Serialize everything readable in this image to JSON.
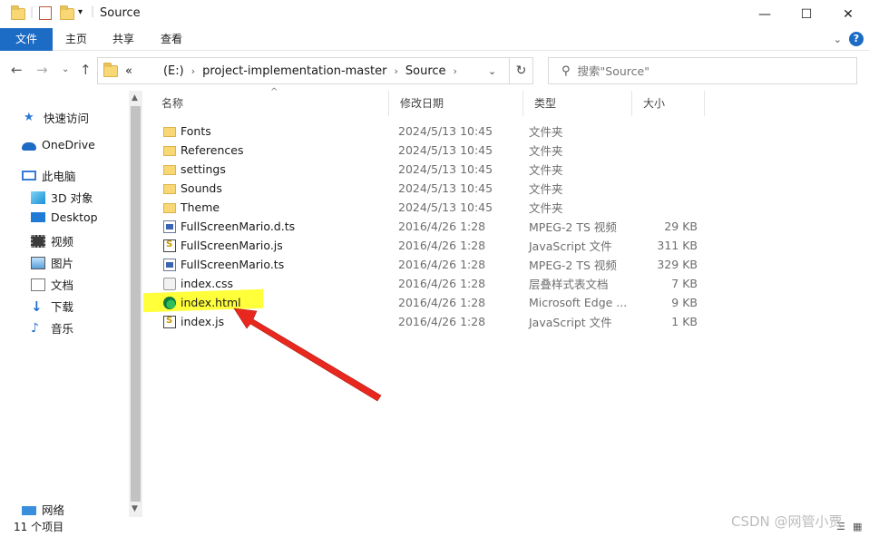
{
  "window": {
    "title": "Source",
    "controls": {
      "minimize": "—",
      "maximize": "☐",
      "close": "✕"
    }
  },
  "ribbon": {
    "tabs": [
      {
        "label": "文件",
        "active": true
      },
      {
        "label": "主页"
      },
      {
        "label": "共享"
      },
      {
        "label": "查看"
      }
    ],
    "help": "?"
  },
  "address": {
    "overflow": "«",
    "crumbs": [
      "(E:)",
      "project-implementation-master",
      "Source"
    ]
  },
  "search": {
    "placeholder": "搜索\"Source\""
  },
  "sidebar": {
    "items": [
      {
        "label": "快速访问",
        "icon": "star-icon"
      },
      {
        "label": "OneDrive",
        "icon": "cloud-icon"
      },
      {
        "label": "此电脑",
        "icon": "computer-icon"
      },
      {
        "label": "3D 对象",
        "icon": "cube-icon"
      },
      {
        "label": "Desktop",
        "icon": "desktop-icon"
      },
      {
        "label": "视频",
        "icon": "video-icon"
      },
      {
        "label": "图片",
        "icon": "picture-icon"
      },
      {
        "label": "文档",
        "icon": "document-icon"
      },
      {
        "label": "下载",
        "icon": "download-icon"
      },
      {
        "label": "音乐",
        "icon": "music-icon"
      },
      {
        "label": "网络",
        "icon": "network-icon"
      }
    ]
  },
  "columns": {
    "name": "名称",
    "date": "修改日期",
    "type": "类型",
    "size": "大小"
  },
  "files": [
    {
      "name": "Fonts",
      "date": "2024/5/13 10:45",
      "type": "文件夹",
      "size": "",
      "icon": "folder"
    },
    {
      "name": "References",
      "date": "2024/5/13 10:45",
      "type": "文件夹",
      "size": "",
      "icon": "folder"
    },
    {
      "name": "settings",
      "date": "2024/5/13 10:45",
      "type": "文件夹",
      "size": "",
      "icon": "folder"
    },
    {
      "name": "Sounds",
      "date": "2024/5/13 10:45",
      "type": "文件夹",
      "size": "",
      "icon": "folder"
    },
    {
      "name": "Theme",
      "date": "2024/5/13 10:45",
      "type": "文件夹",
      "size": "",
      "icon": "folder"
    },
    {
      "name": "FullScreenMario.d.ts",
      "date": "2016/4/26 1:28",
      "type": "MPEG-2 TS 视频",
      "size": "29 KB",
      "icon": "ts"
    },
    {
      "name": "FullScreenMario.js",
      "date": "2016/4/26 1:28",
      "type": "JavaScript 文件",
      "size": "311 KB",
      "icon": "js"
    },
    {
      "name": "FullScreenMario.ts",
      "date": "2016/4/26 1:28",
      "type": "MPEG-2 TS 视频",
      "size": "329 KB",
      "icon": "ts"
    },
    {
      "name": "index.css",
      "date": "2016/4/26 1:28",
      "type": "层叠样式表文档",
      "size": "7 KB",
      "icon": "css"
    },
    {
      "name": "index.html",
      "date": "2016/4/26 1:28",
      "type": "Microsoft Edge ...",
      "size": "9 KB",
      "icon": "edge"
    },
    {
      "name": "index.js",
      "date": "2016/4/26 1:28",
      "type": "JavaScript 文件",
      "size": "1 KB",
      "icon": "js"
    }
  ],
  "status": {
    "count": "11 个项目"
  },
  "watermark": "CSDN @网管小贾",
  "colors": {
    "accent": "#1c6bc4",
    "highlight": "#ffff3a",
    "arrow": "#e8281e"
  }
}
